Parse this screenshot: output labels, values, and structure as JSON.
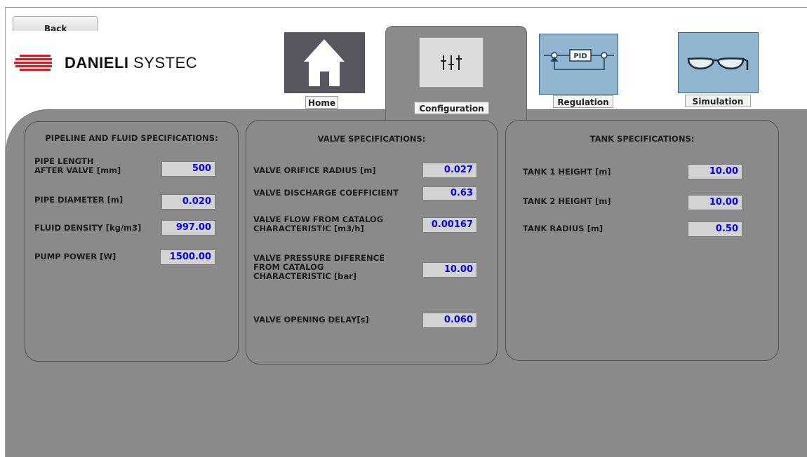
{
  "back_button": {
    "label": "Back"
  },
  "logo": {
    "brand_bold": "DANIELI",
    "brand_light": "SYSTEC"
  },
  "nav": {
    "home": {
      "label": "Home",
      "icon": "house-icon"
    },
    "configuration": {
      "label": "Configuration",
      "icon": "sliders-icon",
      "active": true
    },
    "regulation": {
      "label": "Regulation",
      "icon": "pid-loop-icon",
      "icon_text": "PID"
    },
    "simulation": {
      "label": "Simulation",
      "icon": "glasses-icon"
    }
  },
  "pipeline": {
    "title": "PIPELINE AND FLUID SPECIFICATIONS:",
    "fields": [
      {
        "label_line1": "PIPE LENGTH",
        "label_line2": "AFTER VALVE [mm]",
        "value": "500"
      },
      {
        "label": "PIPE DIAMETER [m]",
        "value": "0.020"
      },
      {
        "label": "FLUID DENSITY [kg/m3]",
        "value": "997.00"
      },
      {
        "label": "PUMP POWER [W]",
        "value": "1500.00"
      }
    ]
  },
  "valve": {
    "title": "VALVE SPECIFICATIONS:",
    "fields": [
      {
        "label": "VALVE ORIFICE RADIUS [m]",
        "value": "0.027"
      },
      {
        "label": "VALVE DISCHARGE COEFFICIENT",
        "value": "0.63"
      },
      {
        "label_line1": "VALVE FLOW  FROM CATALOG",
        "label_line2": "CHARACTERISTIC [m3/h]",
        "value": "0.00167"
      },
      {
        "label_line1": "VALVE PRESSURE DIFERENCE",
        "label_line2": "FROM CATALOG",
        "label_line3": "CHARACTERISTIC [bar]",
        "value": "10.00"
      },
      {
        "label": "VALVE OPENING DELAY[s]",
        "value": "0.060"
      }
    ]
  },
  "tank": {
    "title": "TANK SPECIFICATIONS:",
    "fields": [
      {
        "label": "TANK 1 HEIGHT [m]",
        "value": "10.00"
      },
      {
        "label": "TANK 2 HEIGHT [m]",
        "value": "10.00"
      },
      {
        "label": "TANK RADIUS [m]",
        "value": "0.50"
      }
    ]
  },
  "colors": {
    "panel_bg": "#8a8a8a",
    "value_text": "#0000ff",
    "value_bg": "#d3d3d3",
    "home_icon_bg": "#57575f",
    "active_icon_bg": "#dcdcdc",
    "regulation_icon_bg": "#8fb5d0",
    "simulation_icon_bg": "#8fb5d0"
  }
}
